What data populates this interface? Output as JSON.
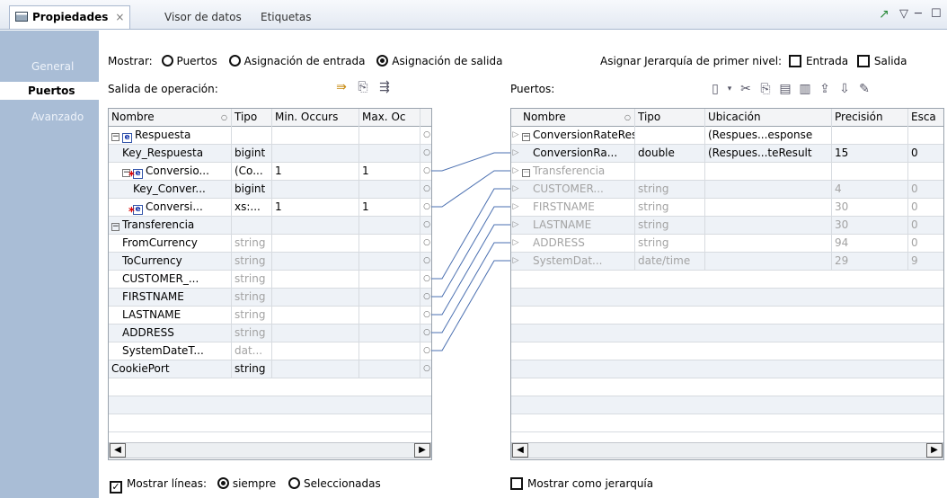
{
  "tabs": [
    {
      "label": "Propiedades",
      "close": "×"
    },
    {
      "label": "Visor de datos"
    },
    {
      "label": "Etiquetas"
    }
  ],
  "window_controls": [
    "▽",
    "─",
    "☐"
  ],
  "sidebar": {
    "items": [
      {
        "label": "General"
      },
      {
        "label": "Puertos"
      },
      {
        "label": "Avanzado"
      }
    ]
  },
  "options": {
    "show_label": "Mostrar:",
    "radios": [
      {
        "label": "Puertos",
        "selected": false
      },
      {
        "label": "Asignación de entrada",
        "selected": false
      },
      {
        "label": "Asignación de salida",
        "selected": true
      }
    ],
    "hierarchy_label": "Asignar Jerarquía de primer nivel:",
    "entrada": "Entrada",
    "salida": "Salida"
  },
  "left_panel": {
    "title": "Salida de operación:",
    "columns": [
      "Nombre",
      "Tipo",
      "Min. Occurs",
      "Max. Oc"
    ],
    "rows": [
      {
        "name": "Respuesta",
        "type": "",
        "min": "",
        "max": "",
        "toggle": "⊟",
        "elem": "e",
        "star": false,
        "indent": 0,
        "gray": false
      },
      {
        "name": "Key_Respuesta",
        "type": "bigint",
        "min": "",
        "max": "",
        "indent": 1,
        "gray": false
      },
      {
        "name": "Conversio...",
        "type": "(Co...",
        "min": "1",
        "max": "1",
        "toggle": "⊟",
        "elem": "e",
        "star": true,
        "indent": 1,
        "gray": false
      },
      {
        "name": "Key_Conver...",
        "type": "bigint",
        "min": "",
        "max": "",
        "indent": 2,
        "gray": false
      },
      {
        "name": "Conversi...",
        "type": "xs:...",
        "min": "1",
        "max": "1",
        "elem": "e",
        "star": true,
        "indent": 2,
        "gray": false
      },
      {
        "name": "Transferencia",
        "type": "",
        "min": "",
        "max": "",
        "toggle": "⊟",
        "indent": 0,
        "gray": false
      },
      {
        "name": "FromCurrency",
        "type": "string",
        "min": "",
        "max": "",
        "indent": 1,
        "gray": true
      },
      {
        "name": "ToCurrency",
        "type": "string",
        "min": "",
        "max": "",
        "indent": 1,
        "gray": true
      },
      {
        "name": "CUSTOMER_...",
        "type": "string",
        "min": "",
        "max": "",
        "indent": 1,
        "gray": true
      },
      {
        "name": "FIRSTNAME",
        "type": "string",
        "min": "",
        "max": "",
        "indent": 1,
        "gray": true
      },
      {
        "name": "LASTNAME",
        "type": "string",
        "min": "",
        "max": "",
        "indent": 1,
        "gray": true
      },
      {
        "name": "ADDRESS",
        "type": "string",
        "min": "",
        "max": "",
        "indent": 1,
        "gray": true
      },
      {
        "name": "SystemDateT...",
        "type": "dat...",
        "min": "",
        "max": "",
        "indent": 1,
        "gray": true
      },
      {
        "name": "CookiePort",
        "type": "string",
        "min": "",
        "max": "",
        "indent": 0,
        "gray": false
      }
    ]
  },
  "right_panel": {
    "title": "Puertos:",
    "columns": [
      "Nombre",
      "Tipo",
      "Ubicación",
      "Precisión",
      "Esca"
    ],
    "rows": [
      {
        "name": "ConversionRateResponse",
        "type": "",
        "loc": "(Respues...esponse",
        "prec": "",
        "scale": "",
        "toggle": "⊟",
        "indent": 0,
        "gray": false
      },
      {
        "name": "ConversionRa...",
        "type": "double",
        "loc": "(Respues...teResult",
        "prec": "15",
        "scale": "0",
        "indent": 1,
        "gray": false
      },
      {
        "name": "Transferencia",
        "type": "",
        "loc": "",
        "prec": "",
        "scale": "",
        "toggle": "⊟",
        "indent": 0,
        "gray": true
      },
      {
        "name": "CUSTOMER...",
        "type": "string",
        "loc": "",
        "prec": "4",
        "scale": "0",
        "indent": 1,
        "gray": true
      },
      {
        "name": "FIRSTNAME",
        "type": "string",
        "loc": "",
        "prec": "30",
        "scale": "0",
        "indent": 1,
        "gray": true
      },
      {
        "name": "LASTNAME",
        "type": "string",
        "loc": "",
        "prec": "30",
        "scale": "0",
        "indent": 1,
        "gray": true
      },
      {
        "name": "ADDRESS",
        "type": "string",
        "loc": "",
        "prec": "94",
        "scale": "0",
        "indent": 1,
        "gray": true
      },
      {
        "name": "SystemDat...",
        "type": "date/time",
        "loc": "",
        "prec": "29",
        "scale": "9",
        "indent": 1,
        "gray": true
      }
    ]
  },
  "mappings": [
    [
      2,
      1
    ],
    [
      4,
      2
    ],
    [
      8,
      3
    ],
    [
      9,
      4
    ],
    [
      10,
      5
    ],
    [
      11,
      6
    ],
    [
      12,
      7
    ]
  ],
  "footer": {
    "show_lines": "Mostrar líneas:",
    "siempre": "siempre",
    "seleccionadas": "Seleccionadas",
    "show_hierarchy": "Mostrar como jerarquía"
  }
}
